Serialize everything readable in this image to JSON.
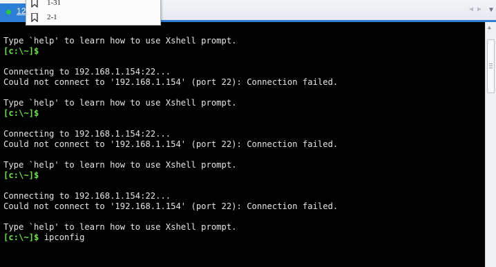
{
  "tab": {
    "number": "1",
    "suffix": "2"
  },
  "bookmarks": [
    {
      "label": "1-31",
      "icon": "bookmark-icon"
    },
    {
      "label": "2-1",
      "icon": "bookmark-icon"
    }
  ],
  "terminal": {
    "prompt": "[c:\\~]$",
    "lines": [
      {
        "kind": "text",
        "text": "Type `help' to learn how to use Xshell prompt."
      },
      {
        "kind": "prompt",
        "cmd": ""
      },
      {
        "kind": "text",
        "text": ""
      },
      {
        "kind": "text",
        "text": "Connecting to 192.168.1.154:22..."
      },
      {
        "kind": "text",
        "text": "Could not connect to '192.168.1.154' (port 22): Connection failed."
      },
      {
        "kind": "text",
        "text": ""
      },
      {
        "kind": "text",
        "text": "Type `help' to learn how to use Xshell prompt."
      },
      {
        "kind": "prompt",
        "cmd": ""
      },
      {
        "kind": "text",
        "text": ""
      },
      {
        "kind": "text",
        "text": "Connecting to 192.168.1.154:22..."
      },
      {
        "kind": "text",
        "text": "Could not connect to '192.168.1.154' (port 22): Connection failed."
      },
      {
        "kind": "text",
        "text": ""
      },
      {
        "kind": "text",
        "text": "Type `help' to learn how to use Xshell prompt."
      },
      {
        "kind": "prompt",
        "cmd": ""
      },
      {
        "kind": "text",
        "text": ""
      },
      {
        "kind": "text",
        "text": "Connecting to 192.168.1.154:22..."
      },
      {
        "kind": "text",
        "text": "Could not connect to '192.168.1.154' (port 22): Connection failed."
      },
      {
        "kind": "text",
        "text": ""
      },
      {
        "kind": "text",
        "text": "Type `help' to learn how to use Xshell prompt."
      },
      {
        "kind": "prompt",
        "cmd": " ipconfig"
      }
    ]
  },
  "colors": {
    "accent": "#2e7ed6",
    "prompt": "#6ee04a",
    "text": "#e6e6e6",
    "background": "#000000"
  }
}
